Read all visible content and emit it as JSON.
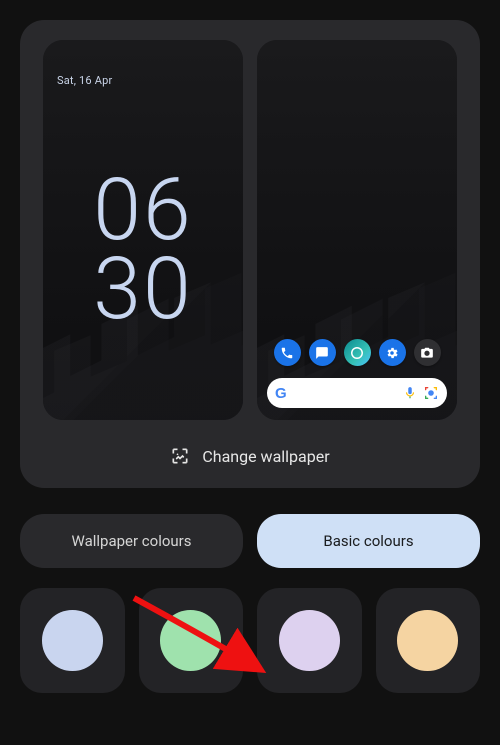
{
  "preview": {
    "date": "Sat, 16 Apr",
    "clock_top": "06",
    "clock_bottom": "30",
    "change_wallpaper_label": "Change wallpaper"
  },
  "dock": [
    {
      "name": "phone",
      "bg": "#1a73e8",
      "glyph": "phone"
    },
    {
      "name": "messages",
      "bg": "#1a73e8",
      "glyph": "chat"
    },
    {
      "name": "edge",
      "bg": "#0b787a",
      "glyph": "edge"
    },
    {
      "name": "settings",
      "bg": "#1a73e8",
      "glyph": "gear"
    },
    {
      "name": "camera",
      "bg": "#2f2f32",
      "glyph": "camera"
    }
  ],
  "tabs": {
    "wallpaper_colours_label": "Wallpaper colours",
    "basic_colours_label": "Basic colours",
    "active": "basic"
  },
  "swatches": [
    {
      "color": "#c9d5ef"
    },
    {
      "color": "#9fe2ad"
    },
    {
      "color": "#ddd1ef"
    },
    {
      "color": "#f5d4a2"
    }
  ]
}
